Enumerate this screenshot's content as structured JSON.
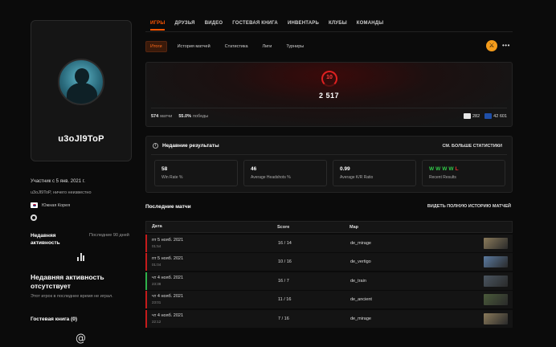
{
  "profile": {
    "username": "u3oJl9ToP",
    "member_since": "Участник с 5 янв. 2021 г.",
    "about": "u3oJl9ToP, ничего неизвестно",
    "country": "Южная Корея",
    "recent_activity_title": "Недавняя активность",
    "recent_activity_period": "Последние 90 дней",
    "no_activity_title": "Недавняя активность отсутствует",
    "no_activity_text": "Этот игрок в последнее время не играл.",
    "guestbook": "Гостевая книга (0)"
  },
  "nav": {
    "tabs": [
      "ИГРЫ",
      "ДРУЗЬЯ",
      "ВИДЕО",
      "ГОСТЕВАЯ КНИГА",
      "ИНВЕНТАРЬ",
      "КЛУБЫ",
      "КОМАНДЫ"
    ],
    "active_tab": 0
  },
  "subnav": {
    "tabs": [
      "Итоги",
      "История матчей",
      "Статистика",
      "Лиги",
      "Турниры"
    ],
    "active_tab": 0
  },
  "hero": {
    "level": "10",
    "elo": "2 517",
    "matches_count": "574",
    "matches_label": "матчи",
    "wins_pct": "55.0%",
    "wins_label": "победы",
    "region_rank_kr": "282",
    "region_rank_eu": "42 601"
  },
  "recent_results": {
    "title": "Недавние результаты",
    "more_link": "СМ. БОЛЬШЕ СТАТИСТИКИ",
    "cards": [
      {
        "value": "58",
        "label": "Win Rate %"
      },
      {
        "value": "46",
        "label": "Average Headshots %"
      },
      {
        "value": "0.99",
        "label": "Average K/R Ratio"
      },
      {
        "value": "",
        "label": "Recent Results"
      }
    ],
    "results": [
      "W",
      "W",
      "W",
      "W",
      "L"
    ]
  },
  "matches": {
    "title": "Последние матчи",
    "link": "ВИДЕТЬ ПОЛНУЮ ИСТОРИЮ МАТЧЕЙ",
    "columns": [
      "Дата",
      "Score",
      "Map"
    ],
    "rows": [
      {
        "date": "пт 5 нояб. 2021",
        "time": "01:54",
        "score": "16 / 14",
        "map": "de_mirage",
        "result": "loss",
        "thumb": "#8a7a5a"
      },
      {
        "date": "пт 5 нояб. 2021",
        "time": "01:04",
        "score": "10 / 16",
        "map": "de_vertigo",
        "result": "loss",
        "thumb": "#5a7aa0"
      },
      {
        "date": "чт 4 нояб. 2021",
        "time": "23:38",
        "score": "16 / 7",
        "map": "de_train",
        "result": "win",
        "thumb": "#4a5560"
      },
      {
        "date": "чт 4 нояб. 2021",
        "time": "23:01",
        "score": "11 / 16",
        "map": "de_ancient",
        "result": "loss",
        "thumb": "#4a5a3a"
      },
      {
        "date": "чт 4 нояб. 2021",
        "time": "22:12",
        "score": "7 / 16",
        "map": "de_mirage",
        "result": "loss",
        "thumb": "#8a7a5a"
      }
    ]
  }
}
